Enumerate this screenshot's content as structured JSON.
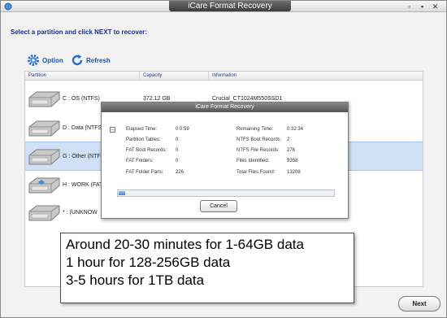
{
  "window": {
    "title": "iCare Format Recovery",
    "minimize_glyph": "▫",
    "restore_glyph": "▪",
    "close_glyph": "✕"
  },
  "instructions": "Select a partition and click NEXT to recover:",
  "toolbar": {
    "option_label": "Option",
    "refresh_label": "Refresh",
    "icons": [
      "gear-icon",
      "refresh-icon"
    ]
  },
  "table": {
    "headers": [
      "Partition",
      "Capacity",
      "Information"
    ],
    "rows": [
      {
        "partition": "C : OS (NTFS)",
        "capacity": "372.12 GB",
        "information": "Crucial_CT1024M550SSD1",
        "selected": false
      },
      {
        "partition": "D : Data (NTFS",
        "capacity": "",
        "information": "",
        "selected": false
      },
      {
        "partition": "G : Other (NTF",
        "capacity": "",
        "information": "",
        "selected": true
      },
      {
        "partition": "H : WORK (FAT",
        "capacity": "",
        "information": "",
        "selected": false
      },
      {
        "partition": "* :  (UNKNOW",
        "capacity": "",
        "information": "",
        "selected": false
      }
    ]
  },
  "dialog": {
    "title": "iCare Format Recovery",
    "collapse_glyph": "–",
    "left_stats": [
      {
        "label": "Elapsed Time:",
        "value": "0:0:59"
      },
      {
        "label": "Partition Tables:",
        "value": "0"
      },
      {
        "label": "FAT Boot Records:",
        "value": "0"
      },
      {
        "label": "FAT Folders:",
        "value": "0"
      },
      {
        "label": "FAT Folder Parts:",
        "value": "226"
      }
    ],
    "right_stats": [
      {
        "label": "Remaining Time:",
        "value": "0:32:34"
      },
      {
        "label": "NTFS Boot Records:",
        "value": "2"
      },
      {
        "label": "NTFS File Records:",
        "value": "276"
      },
      {
        "label": "Files Identified:",
        "value": "9358"
      },
      {
        "label": "Total Files Found:",
        "value": "13208"
      }
    ],
    "progress_fraction": 0.03,
    "cancel_label": "Cancel"
  },
  "note": {
    "lines": [
      "Around 20-30 minutes for 1-64GB data",
      "1 hour for 128-256GB data",
      "3-5 hours for 1TB data"
    ]
  },
  "footer": {
    "next_label": "Next"
  },
  "colors": {
    "accent": "#1c5aa8",
    "selected_row": "#cfe0f7",
    "progress": "#3d86d1"
  }
}
